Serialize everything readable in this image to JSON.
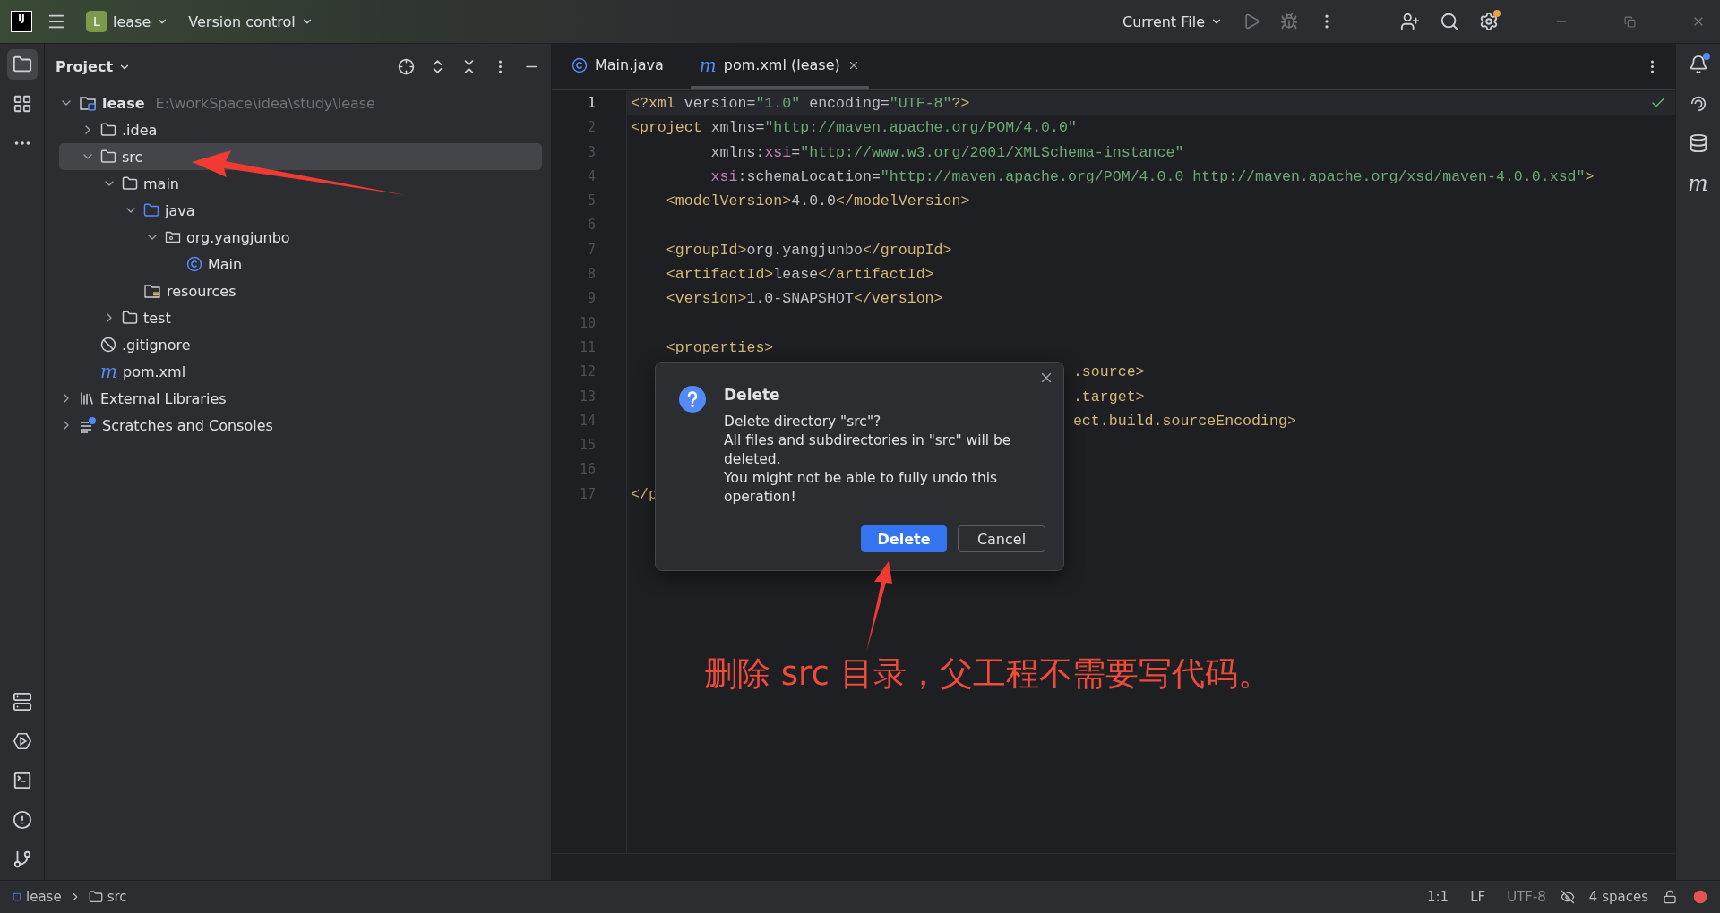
{
  "title_bar": {
    "logo": "IJ",
    "project_badge": "L",
    "project": "lease",
    "vcs": "Version control",
    "run_config": "Current File"
  },
  "project_panel": {
    "title": "Project",
    "tree": [
      {
        "label": "lease",
        "hint": "E:\\workSpace\\idea\\study\\lease",
        "kind": "module",
        "expanded": true,
        "selected": false,
        "children": [
          {
            "label": ".idea",
            "kind": "folder",
            "expanded": false,
            "selected": false
          },
          {
            "label": "src",
            "kind": "folder",
            "expanded": true,
            "selected": true,
            "children": [
              {
                "label": "main",
                "kind": "folder",
                "expanded": true,
                "selected": false,
                "children": [
                  {
                    "label": "java",
                    "kind": "source",
                    "expanded": true,
                    "selected": false,
                    "children": [
                      {
                        "label": "org.yangjunbo",
                        "kind": "package",
                        "expanded": true,
                        "selected": false,
                        "children": [
                          {
                            "label": "Main",
                            "kind": "class",
                            "selected": false
                          }
                        ]
                      }
                    ]
                  },
                  {
                    "label": "resources",
                    "kind": "resources",
                    "selected": false
                  }
                ]
              },
              {
                "label": "test",
                "kind": "folder",
                "expanded": false,
                "selected": false
              }
            ]
          },
          {
            "label": ".gitignore",
            "kind": "ignore",
            "selected": false
          },
          {
            "label": "pom.xml",
            "kind": "maven",
            "glyph": "m",
            "selected": false
          }
        ]
      },
      {
        "label": "External Libraries",
        "kind": "libraries",
        "expanded": false,
        "selected": false
      },
      {
        "label": "Scratches and Consoles",
        "kind": "scratches",
        "expanded": false,
        "selected": false
      }
    ]
  },
  "tabs": [
    {
      "label": "Main.java",
      "kind": "class",
      "selected": false,
      "closable": false
    },
    {
      "label": "pom.xml (lease)",
      "kind": "maven",
      "glyph": "m",
      "selected": true,
      "closable": true
    }
  ],
  "code_lines": [
    {
      "number": "1",
      "current": true,
      "segments": [
        {
          "kind": "tag",
          "text": "<?xml"
        },
        {
          "kind": "attr",
          "text": " version"
        },
        {
          "kind": "text",
          "text": "="
        },
        {
          "kind": "value",
          "text": "\"1.0\""
        },
        {
          "kind": "attr",
          "text": " encoding"
        },
        {
          "kind": "text",
          "text": "="
        },
        {
          "kind": "value",
          "text": "\"UTF-8\""
        },
        {
          "kind": "tag",
          "text": "?>"
        }
      ]
    },
    {
      "number": "2",
      "current": false,
      "segments": [
        {
          "kind": "tag",
          "text": "<project"
        },
        {
          "kind": "attr",
          "text": " xmlns"
        },
        {
          "kind": "text",
          "text": "="
        },
        {
          "kind": "value",
          "text": "\"http://maven.apache.org/POM/4.0.0\""
        }
      ]
    },
    {
      "number": "3",
      "current": false,
      "segments": [
        {
          "kind": "attr",
          "text": "         xmlns:"
        },
        {
          "kind": "ns",
          "text": "xsi"
        },
        {
          "kind": "text",
          "text": "="
        },
        {
          "kind": "value",
          "text": "\"http://www.w3.org/2001/XMLSchema-instance\""
        }
      ]
    },
    {
      "number": "4",
      "current": false,
      "segments": [
        {
          "kind": "ns",
          "text": "         xsi"
        },
        {
          "kind": "attr",
          "text": ":schemaLocation"
        },
        {
          "kind": "text",
          "text": "="
        },
        {
          "kind": "value",
          "text": "\"http://maven.apache.org/POM/4.0.0 http://maven.apache.org/xsd/maven-4.0.0.xsd\""
        },
        {
          "kind": "tag",
          "text": ">"
        }
      ]
    },
    {
      "number": "5",
      "current": false,
      "segments": [
        {
          "kind": "tag",
          "text": "    <modelVersion>"
        },
        {
          "kind": "text",
          "text": "4.0.0"
        },
        {
          "kind": "tag",
          "text": "</modelVersion>"
        }
      ]
    },
    {
      "number": "6",
      "current": false
    },
    {
      "number": "7",
      "current": false,
      "segments": [
        {
          "kind": "tag",
          "text": "    <groupId>"
        },
        {
          "kind": "text",
          "text": "org.yangjunbo"
        },
        {
          "kind": "tag",
          "text": "</groupId>"
        }
      ]
    },
    {
      "number": "8",
      "current": false,
      "segments": [
        {
          "kind": "tag",
          "text": "    <artifactId>"
        },
        {
          "kind": "text",
          "text": "lease"
        },
        {
          "kind": "tag",
          "text": "</artifactId>"
        }
      ]
    },
    {
      "number": "9",
      "current": false,
      "segments": [
        {
          "kind": "tag",
          "text": "    <version>"
        },
        {
          "kind": "text",
          "text": "1.0-SNAPSHOT"
        },
        {
          "kind": "tag",
          "text": "</version>"
        }
      ]
    },
    {
      "number": "10",
      "current": false
    },
    {
      "number": "11",
      "current": false,
      "segments": [
        {
          "kind": "tag",
          "text": "    <properties>"
        }
      ]
    },
    {
      "number": "12",
      "current": false,
      "clipped": true,
      "segments": [
        {
          "kind": "tag",
          "text": ".source>"
        }
      ]
    },
    {
      "number": "13",
      "current": false,
      "clipped": true,
      "segments": [
        {
          "kind": "tag",
          "text": ".target>"
        }
      ]
    },
    {
      "number": "14",
      "current": false,
      "clipped": true,
      "segments": [
        {
          "kind": "tag",
          "text": "ect.build.sourceEncoding>"
        }
      ]
    },
    {
      "number": "15",
      "current": false
    },
    {
      "number": "16",
      "current": false
    },
    {
      "number": "17",
      "current": false,
      "segments": [
        {
          "kind": "tag",
          "text": "</p"
        }
      ]
    }
  ],
  "dialog": {
    "title": "Delete",
    "lines": [
      "Delete directory \"src\"?",
      "All files and subdirectories in \"src\" will be deleted.",
      "You might not be able to fully undo this operation!"
    ],
    "buttons": [
      {
        "label": "Delete",
        "kind": "primary"
      },
      {
        "label": "Cancel",
        "kind": "secondary"
      }
    ]
  },
  "annotation": "删除 src 目录，父工程不需要写代码。",
  "right_strip": {
    "maven_glyph": "m"
  },
  "status_bar": {
    "breadcrumbs": [
      "lease",
      "src"
    ],
    "position": "1:1",
    "line_ending": "LF",
    "encoding": "UTF-8",
    "indent": "4 spaces"
  }
}
